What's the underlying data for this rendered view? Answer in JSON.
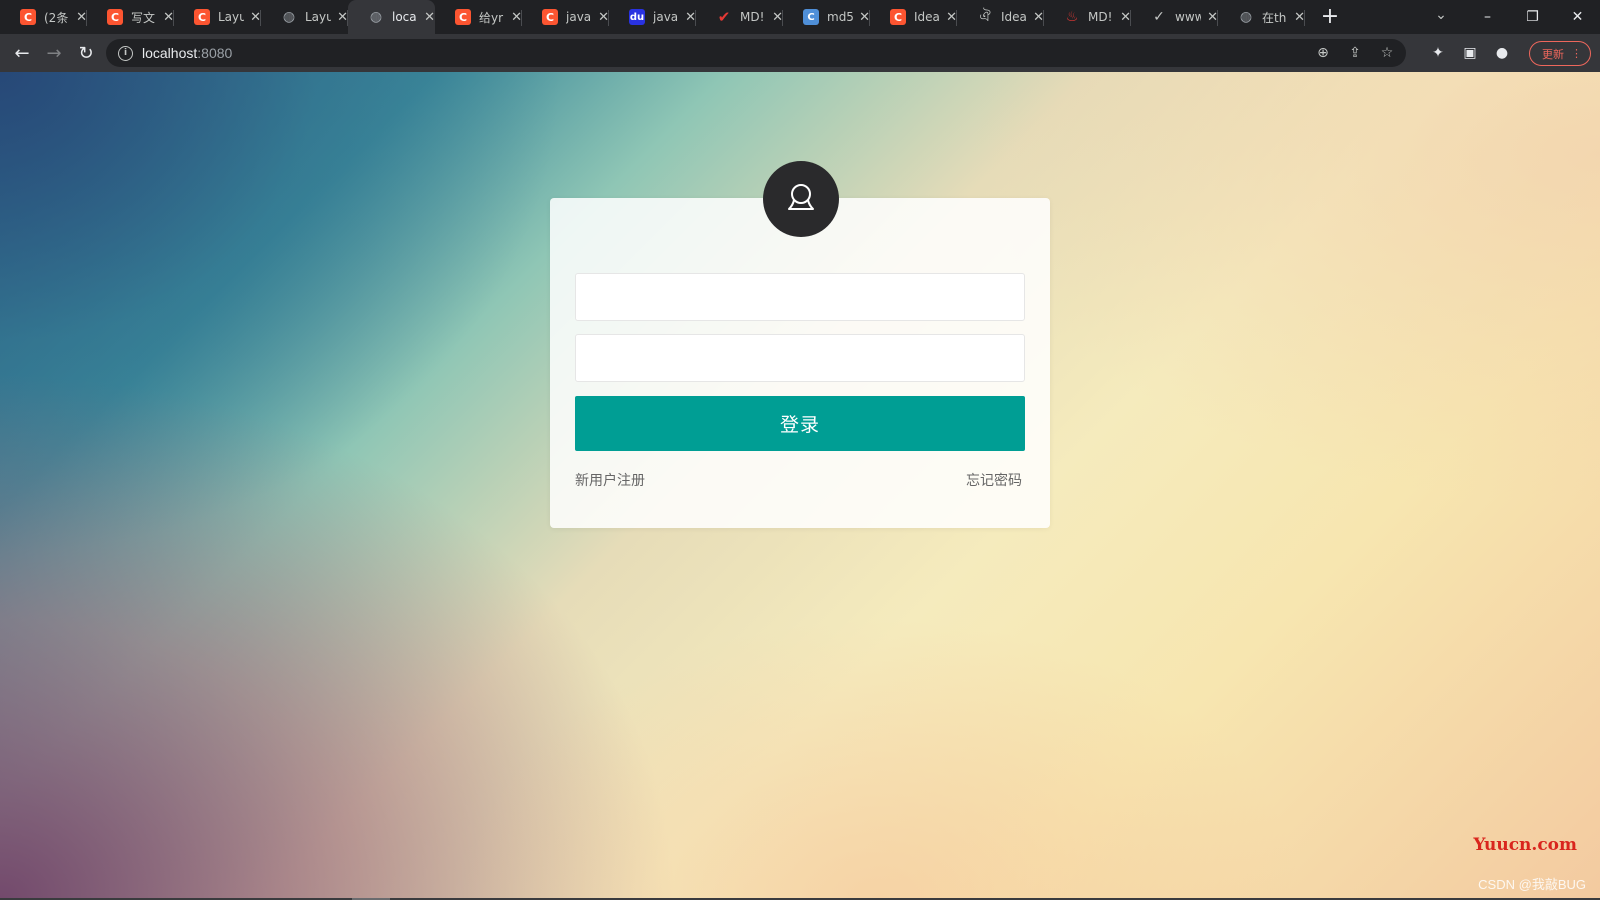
{
  "browser": {
    "tabs": [
      {
        "favicon": "csdn-icon",
        "title": "(2条",
        "active": false
      },
      {
        "favicon": "csdn-icon",
        "title": "写文",
        "active": false
      },
      {
        "favicon": "csdn-icon",
        "title": "Layu",
        "active": false
      },
      {
        "favicon": "globe-icon",
        "title": "Layu",
        "active": false
      },
      {
        "favicon": "globe-icon",
        "title": "loca",
        "active": true
      },
      {
        "favicon": "csdn-icon",
        "title": "给yr",
        "active": false
      },
      {
        "favicon": "csdn-icon",
        "title": "java",
        "active": false
      },
      {
        "favicon": "baidu-icon",
        "title": "java",
        "active": false
      },
      {
        "favicon": "check-icon",
        "title": "MD!",
        "active": false
      },
      {
        "favicon": "md5-icon",
        "title": "md5",
        "active": false
      },
      {
        "favicon": "csdn-icon",
        "title": "Idea",
        "active": false
      },
      {
        "favicon": "idea-icon",
        "title": "Idea",
        "active": false
      },
      {
        "favicon": "fire-icon",
        "title": "MD!",
        "active": false
      },
      {
        "favicon": "tick-icon",
        "title": "www",
        "active": false
      },
      {
        "favicon": "globe-icon",
        "title": "在th",
        "active": false
      }
    ],
    "url": {
      "host": "localhost",
      "port": ":8080"
    },
    "update_label": "更新"
  },
  "login": {
    "username_value": "",
    "password_value": "",
    "login_label": "登录",
    "register_label": "新用户注册",
    "forgot_label": "忘记密码"
  },
  "watermarks": {
    "site": "Yuucn.com",
    "author": "CSDN @我敲BUG"
  },
  "colors": {
    "login_button": "#009e94",
    "avatar_bg": "#2a2a2c",
    "chrome_dark": "#202124",
    "chrome_toolbar": "#35363a",
    "update_accent": "#ee675c"
  }
}
